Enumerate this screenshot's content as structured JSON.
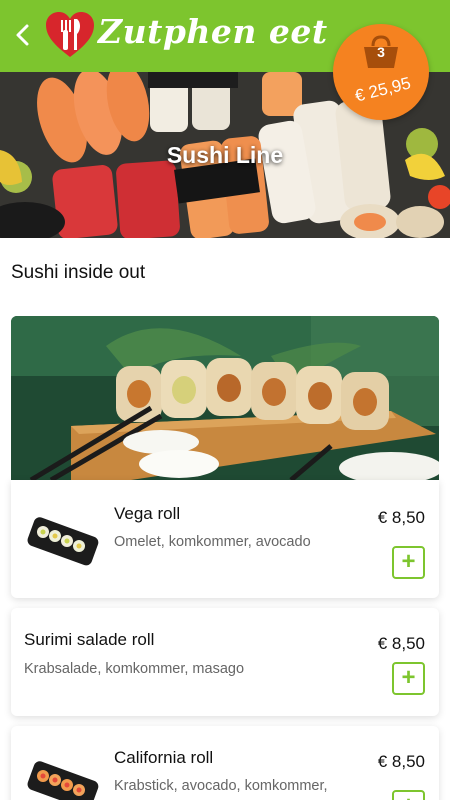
{
  "header": {
    "back_icon": "chevron-left-icon",
    "logo_icon": "heart-cutlery-logo",
    "brand": "Zutphen eet"
  },
  "cart": {
    "icon": "basket-icon",
    "count": "3",
    "total": "€ 25,95",
    "color": "#f58220"
  },
  "hero": {
    "title": "Sushi Line"
  },
  "section": {
    "title": "Sushi inside out"
  },
  "items": [
    {
      "name": "Vega roll",
      "description": "Omelet, komkommer, avocado",
      "price": "€ 8,50",
      "add_label": "+"
    },
    {
      "name": "Surimi salade roll",
      "description": "Krabsalade, komkommer, masago",
      "price": "€ 8,50",
      "add_label": "+"
    },
    {
      "name": "California roll",
      "description": "Krabstick, avocado, komkommer,",
      "price": "€ 8,50",
      "add_label": "+"
    }
  ],
  "colors": {
    "accent": "#7dc52e",
    "cart": "#f58220",
    "text": "#111111",
    "muted": "#666666"
  }
}
